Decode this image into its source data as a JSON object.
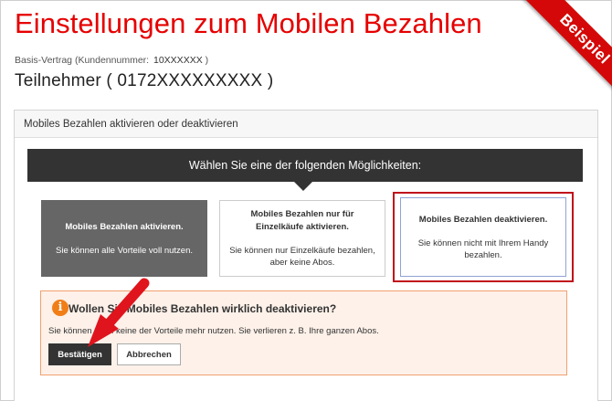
{
  "header": {
    "title": "Einstellungen zum Mobilen Bezahlen",
    "contract_label": "Basis-Vertrag (Kundennummer:",
    "contract_number": "10XXXXXX",
    "contract_close": ")",
    "participant": "Teilnehmer ( 0172XXXXXXXXX )"
  },
  "ribbon": {
    "label": "Beispiel"
  },
  "panel": {
    "header": "Mobiles Bezahlen aktivieren oder deaktivieren",
    "prompt": "Wählen Sie eine der folgenden Möglichkeiten:",
    "options": [
      {
        "title": "Mobiles Bezahlen aktivieren.",
        "desc": "Sie können alle Vorteile voll nutzen."
      },
      {
        "title": "Mobiles Bezahlen nur für Einzelkäufe aktivieren.",
        "desc": "Sie können nur Einzelkäufe bezahlen, aber keine Abos."
      },
      {
        "title": "Mobiles Bezahlen deaktivieren.",
        "desc": "Sie können nicht mit Ihrem Handy bezahlen."
      }
    ]
  },
  "warning": {
    "title": "Wollen Sie Mobiles Bezahlen wirklich deaktivieren?",
    "text": "Sie können dann keine der Vorteile mehr nutzen. Sie verlieren z. B. Ihre ganzen Abos.",
    "confirm_label": "Bestätigen",
    "cancel_label": "Abbrechen"
  },
  "colors": {
    "brand": "#e60000",
    "dark": "#333333",
    "warning_bg": "#fdf1e9",
    "warning_icon": "#f07f17"
  },
  "icons": {
    "warning": "info-warning-icon",
    "pointer": "red-arrow-icon"
  }
}
